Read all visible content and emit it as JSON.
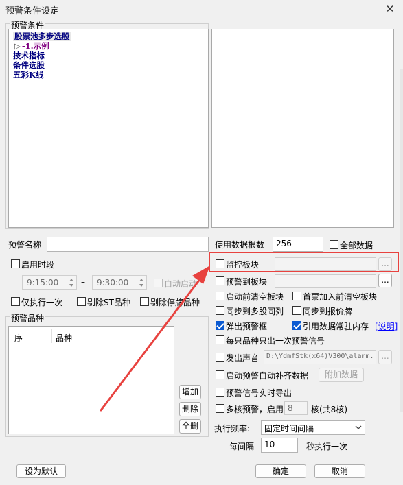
{
  "window": {
    "title": "预警条件设定",
    "close_glyph": "✕"
  },
  "conditions": {
    "label": "预警条件",
    "tree": [
      {
        "text": "股票池多步选股"
      },
      {
        "text": "-1.示例",
        "prefix": "▷"
      },
      {
        "text": "技术指标"
      },
      {
        "text": "条件选股"
      },
      {
        "text": "五彩K线"
      }
    ]
  },
  "alert_name": {
    "label": "预警名称",
    "value": ""
  },
  "data_count": {
    "label": "使用数据根数",
    "value": "256",
    "all_label": "全部数据"
  },
  "time": {
    "enable_label": "启用时段",
    "start": "9:15:00",
    "separator": "–",
    "end": "9:30:00",
    "auto_start_label": "自动启动"
  },
  "options_left": {
    "run_once": "仅执行一次",
    "exclude_st": "剔除ST品种",
    "exclude_suspended": "剔除停牌品种"
  },
  "varieties": {
    "label": "预警品种",
    "col_index": "序",
    "col_name": "品种",
    "add": "增加",
    "delete": "删除",
    "delete_all": "全删"
  },
  "options_right": {
    "monitor_block": "监控板块",
    "alert_to_block": "预警到板块",
    "clear_block_on_start": "启动前清空板块",
    "first_join_clear": "首票加入前清空板块",
    "sync_multi": "同步到多股同列",
    "sync_quote": "同步到报价牌",
    "popup": "弹出预警框",
    "ref_memory": "引用数据常驻内存",
    "help_link": "[说明]",
    "once_per_stock": "每只品种只出一次预警信号",
    "sound": "发出声音",
    "sound_path": "D:\\YdmfStk(x64)V300\\alarm.",
    "auto_fill": "启动预警自动补齐数据",
    "add_data": "附加数据",
    "realtime_export": "预警信号实时导出",
    "multicore": "多核预警，启用",
    "core_count": "8",
    "core_suffix": "核(共8核)"
  },
  "frequency": {
    "label": "执行频率:",
    "value": "固定时间间隔",
    "interval_label": "每间隔",
    "interval_value": "10",
    "interval_suffix": "秒执行一次"
  },
  "buttons": {
    "browse": "...",
    "set_default": "设为默认",
    "ok": "确定",
    "cancel": "取消"
  },
  "colors": {
    "highlight_box": "#e8423f",
    "arrow": "#e8423f",
    "checkbox_checked": "#0a5ad2",
    "tree_text": "#000080",
    "tree_sub_text": "#800080",
    "link": "#0000ff"
  }
}
